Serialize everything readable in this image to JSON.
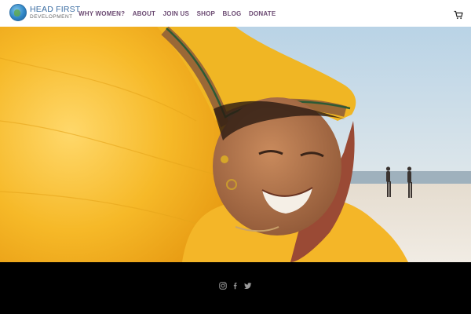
{
  "logo": {
    "line1": "HEAD FIRST",
    "line2": "DEVELOPMENT"
  },
  "nav": {
    "items": [
      {
        "label": "WHY WOMEN?"
      },
      {
        "label": "ABOUT"
      },
      {
        "label": "JOIN US"
      },
      {
        "label": "SHOP"
      },
      {
        "label": "BLOG"
      },
      {
        "label": "DONATE"
      }
    ]
  },
  "icons": {
    "logo": "globe-icon",
    "cart": "cart-icon",
    "social": [
      "instagram-icon",
      "facebook-icon",
      "twitter-icon"
    ]
  },
  "colors": {
    "nav_text": "#6b4a72",
    "logo_blue": "#3c6ea3",
    "footer": "#000000",
    "scarf": "#f3b323"
  }
}
